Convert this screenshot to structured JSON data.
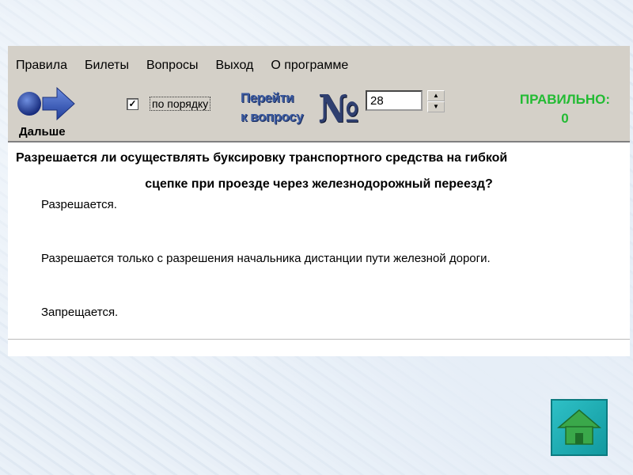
{
  "menu": [
    "Правила",
    "Билеты",
    "Вопросы",
    "Выход",
    "О программе"
  ],
  "toolbar": {
    "next_label": "Дальше",
    "order_checked": true,
    "order_label": "по порядку",
    "goto_line1": "Перейти",
    "goto_line2": "к вопросу",
    "number_sign": "№",
    "question_number": "28",
    "result_label": "ПРАВИЛЬНО:",
    "result_count": "0"
  },
  "question": {
    "line1": "Разрешается ли осуществлять буксировку транспортного средства на гибкой",
    "line2": "сцепке при проезде через железнодорожный переезд?"
  },
  "answers": [
    "Разрешается.",
    "Разрешается только с разрешения начальника дистанции пути железной дороги.",
    "Запрещается."
  ],
  "icons": {
    "next": "arrow-right-icon",
    "home": "home-icon"
  },
  "colors": {
    "result": "#22bb33",
    "goto_text": "#3b5aa0",
    "home_button": "#1fb0b6",
    "home_house": "#3aa84a"
  }
}
